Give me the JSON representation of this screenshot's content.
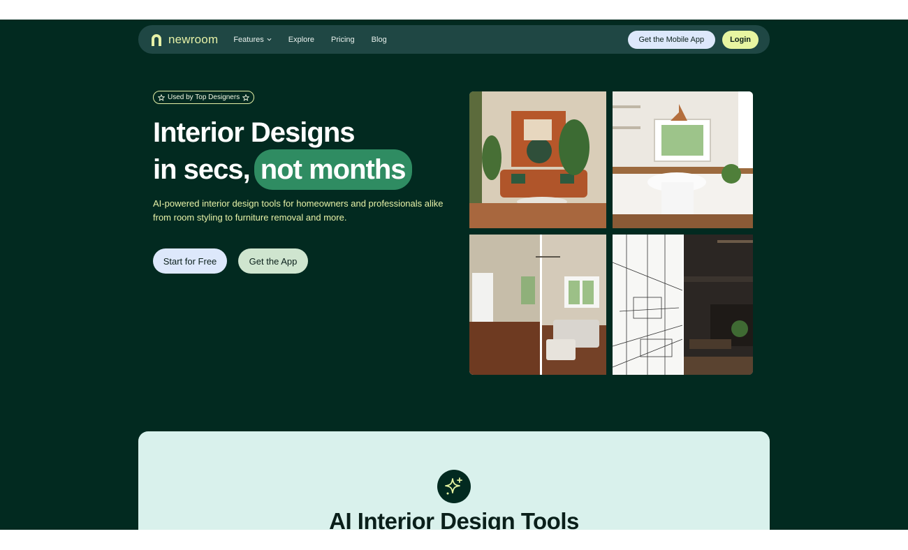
{
  "nav": {
    "logo_text": "newroom",
    "links": [
      {
        "label": "Features",
        "has_dropdown": true
      },
      {
        "label": "Explore"
      },
      {
        "label": "Pricing"
      },
      {
        "label": "Blog"
      }
    ],
    "mobile_app_label": "Get the Mobile App",
    "login_label": "Login"
  },
  "hero": {
    "badge": "Used by Top Designers",
    "headline_line1": "Interior Designs",
    "headline_line2_prefix": "in secs,",
    "headline_highlight": "not months",
    "subtitle": "AI-powered interior design tools for homeowners and professionals alike from room styling to furniture removal and more.",
    "start_label": "Start for Free",
    "app_label": "Get the App"
  },
  "tools_section": {
    "icon": "sparkle-icon",
    "title": "AI Interior Design Tools"
  },
  "colors": {
    "background": "#022a20",
    "nav_bg": "#1f4744",
    "accent_green": "#2f8c62",
    "accent_yellow": "#e7f5a1",
    "accent_blue": "#dde8fb",
    "section_bg": "#d9f1ec"
  }
}
